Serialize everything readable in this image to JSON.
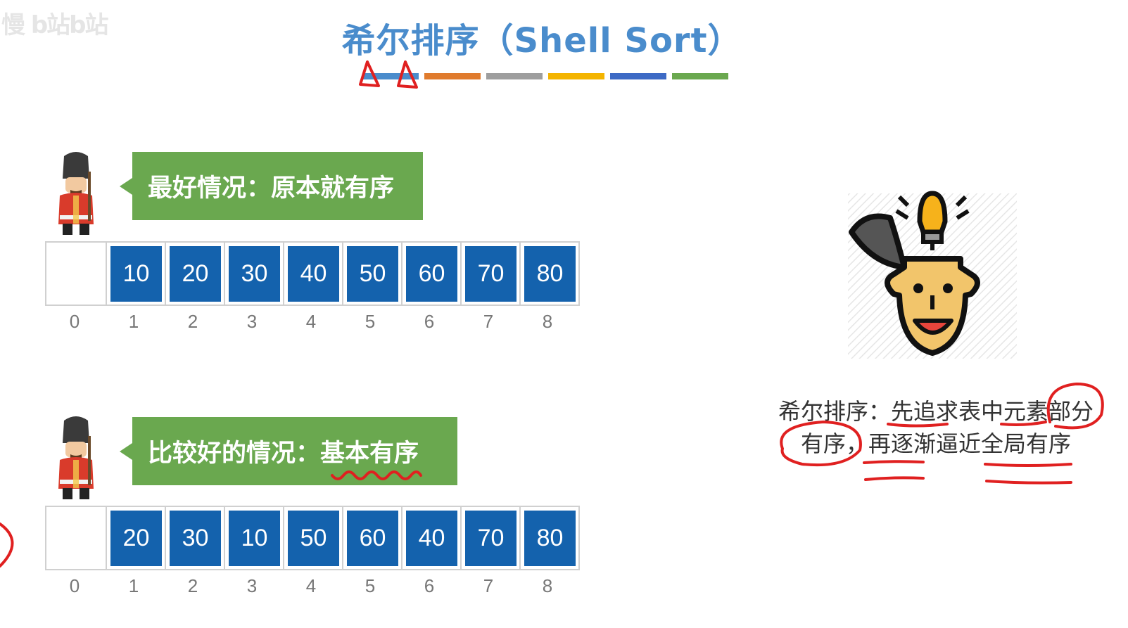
{
  "watermark": "慢 b站b站",
  "title": "希尔排序（Shell Sort）",
  "title_bar_colors": [
    "#4a8ccc",
    "#e07b2d",
    "#9e9e9e",
    "#f4b400",
    "#3d6ac5",
    "#6aa84f"
  ],
  "scenario_best": {
    "label": "最好情况：原本就有序",
    "values": [
      "",
      "10",
      "20",
      "30",
      "40",
      "50",
      "60",
      "70",
      "80"
    ],
    "indices": [
      "0",
      "1",
      "2",
      "3",
      "4",
      "5",
      "6",
      "7",
      "8"
    ]
  },
  "scenario_good": {
    "label": "比较好的情况：基本有序",
    "values": [
      "",
      "20",
      "30",
      "10",
      "50",
      "60",
      "40",
      "70",
      "80"
    ],
    "indices": [
      "0",
      "1",
      "2",
      "3",
      "4",
      "5",
      "6",
      "7",
      "8"
    ]
  },
  "note": {
    "line1": "希尔排序：先追求表中元素部分",
    "line2": "有序，再逐渐逼近全局有序"
  },
  "icons": {
    "guard": "royal-guard-icon",
    "idea": "lightbulb-head-icon"
  },
  "colors": {
    "title": "#4a8ccc",
    "bubble": "#6aa84f",
    "cell": "#1462ad",
    "annotation": "#e02020"
  }
}
